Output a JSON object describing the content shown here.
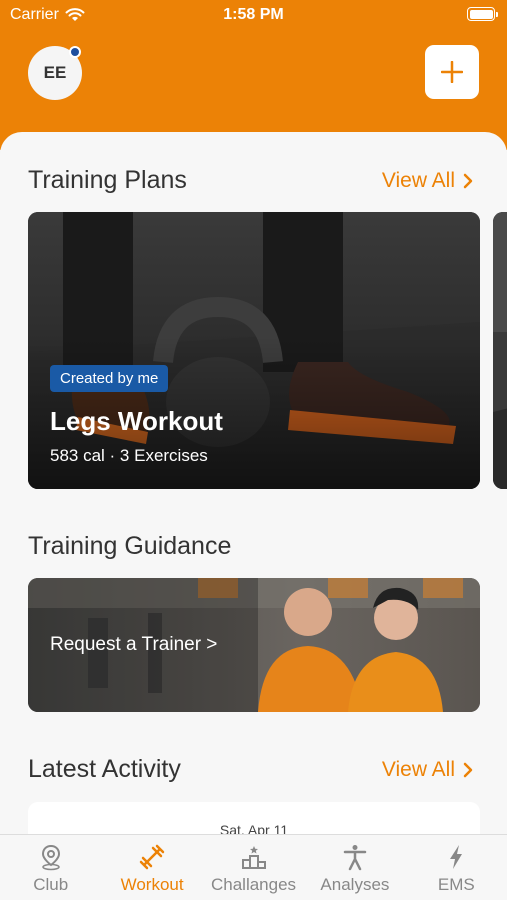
{
  "status_bar": {
    "carrier": "Carrier",
    "time": "1:58 PM"
  },
  "header": {
    "avatar_initials": "EE"
  },
  "training_plans": {
    "title": "Training Plans",
    "view_all": "View All",
    "card": {
      "badge": "Created by me",
      "title": "Legs Workout",
      "meta": "583 cal · 3 Exercises"
    }
  },
  "training_guidance": {
    "title": "Training Guidance",
    "cta": "Request a Trainer >"
  },
  "latest_activity": {
    "title": "Latest Activity",
    "view_all": "View All",
    "date": "Sat, Apr 11"
  },
  "tabs": [
    {
      "label": "Club",
      "icon": "map-pin-icon"
    },
    {
      "label": "Workout",
      "icon": "dumbbell-icon"
    },
    {
      "label": "Challanges",
      "icon": "podium-icon"
    },
    {
      "label": "Analyses",
      "icon": "person-icon"
    },
    {
      "label": "EMS",
      "icon": "lightning-icon"
    }
  ],
  "active_tab": "Workout",
  "colors": {
    "accent": "#ec8206",
    "badge": "#1a5aa6"
  }
}
